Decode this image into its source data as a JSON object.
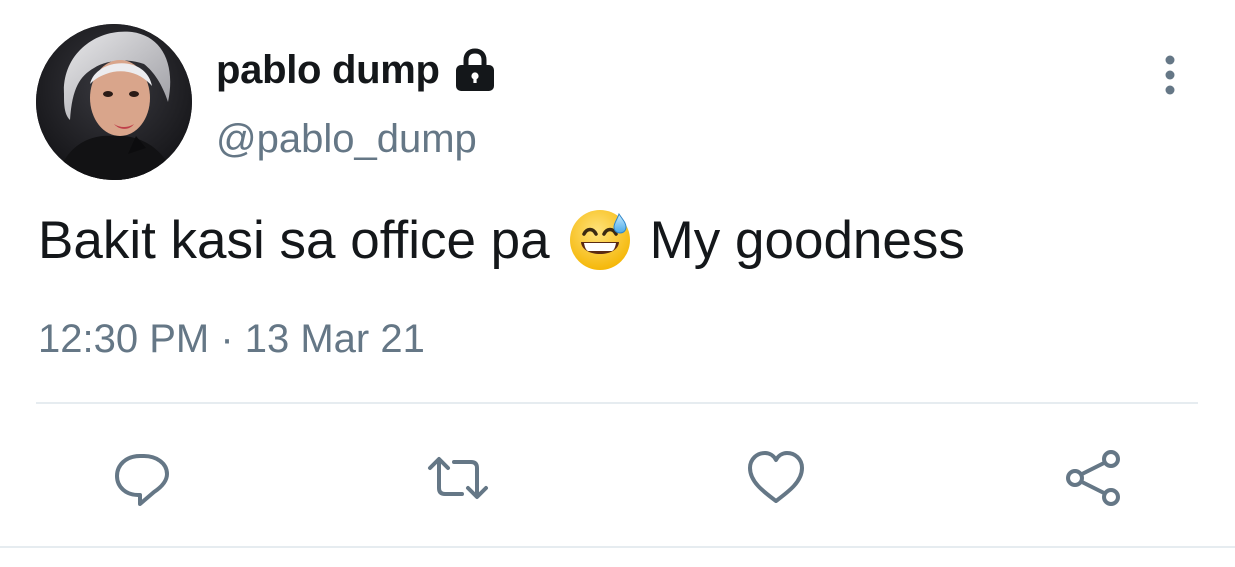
{
  "tweet": {
    "display_name": "pablo dump",
    "handle": "@pablo_dump",
    "text_before_emoji": "Bakit kasi sa office pa",
    "emoji": "grinning-face-with-sweat",
    "text_after_emoji": "My goodness",
    "timestamp": "12:30 PM · 13 Mar 21",
    "protected_account_icon": "lock-icon"
  },
  "actions": {
    "reply_icon": "reply-icon",
    "retweet_icon": "retweet-icon",
    "like_icon": "heart-icon",
    "share_icon": "share-icon"
  },
  "colors": {
    "text": "#14171a",
    "secondary": "#657786",
    "divider": "#e6ecf0",
    "icon": "#657786"
  }
}
